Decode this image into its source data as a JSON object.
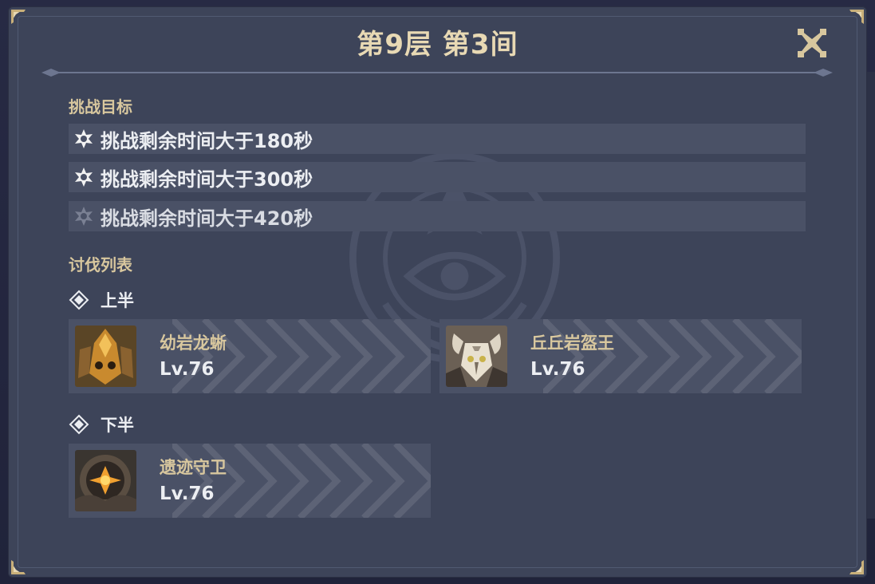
{
  "title": "第9层 第3间",
  "close_icon": "close-icon",
  "goals": {
    "heading": "挑战目标",
    "items": [
      {
        "text": "挑战剩余时间大于180秒",
        "achieved": true
      },
      {
        "text": "挑战剩余时间大于300秒",
        "achieved": true
      },
      {
        "text": "挑战剩余时间大于420秒",
        "achieved": false
      }
    ]
  },
  "hunt": {
    "heading": "讨伐列表",
    "first_half": {
      "label": "上半",
      "enemies": [
        {
          "name": "幼岩龙蜥",
          "level": "Lv.76",
          "icon": "geovishap-hatchling-portrait"
        },
        {
          "name": "丘丘岩盔王",
          "level": "Lv.76",
          "icon": "mitachurl-king-portrait"
        }
      ]
    },
    "second_half": {
      "label": "下半",
      "enemies": [
        {
          "name": "遗迹守卫",
          "level": "Lv.76",
          "icon": "ruin-guard-portrait"
        }
      ]
    }
  },
  "colors": {
    "panel": "#3d4459",
    "row": "#4a5166",
    "title": "#e8d9b4",
    "heading": "#d8c79e",
    "text": "#eceef2"
  }
}
